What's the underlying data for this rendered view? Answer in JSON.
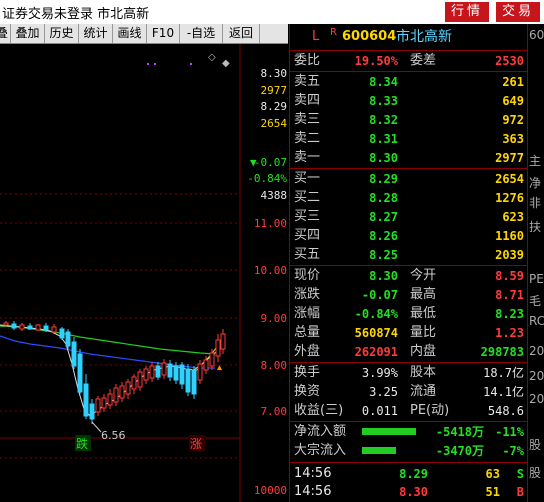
{
  "titlebar": {
    "status_text": "证券交易未登录  市北高新",
    "quote_button": "行情",
    "trade_button": "交易"
  },
  "toolbar": {
    "items": [
      "叠加",
      "历史",
      "统计",
      "画线",
      "F10",
      "-自选",
      "返回"
    ],
    "left_fragment": "叠"
  },
  "chart": {
    "price_axis": [
      "8.30",
      "2977",
      "8.29",
      "2654",
      "-0.07",
      "-0.84%",
      "4388"
    ],
    "grid_labels": [
      "11.00",
      "10.00",
      "9.00",
      "8.00",
      "7.00"
    ],
    "bottom_label": "10000",
    "low_annotation": "6.56",
    "tag_fall": "跌",
    "tag_rise": "涨",
    "colors": {
      "grid": "#7a0000",
      "candle_up": "#ff3b3b",
      "candle_down": "#30d0ff",
      "ma_green": "#22cc22",
      "ma_blue": "#2a4cff"
    }
  },
  "panel": {
    "header": {
      "letter": "L",
      "marker": "R",
      "code": "600604",
      "name": "市北高新"
    },
    "ratio": {
      "label": "委比",
      "pct": "19.50%",
      "label2": "委差",
      "value": "2530"
    },
    "asks": [
      {
        "label": "卖五",
        "price": "8.34",
        "vol": "261"
      },
      {
        "label": "卖四",
        "price": "8.33",
        "vol": "649"
      },
      {
        "label": "卖三",
        "price": "8.32",
        "vol": "972"
      },
      {
        "label": "卖二",
        "price": "8.31",
        "vol": "363"
      },
      {
        "label": "卖一",
        "price": "8.30",
        "vol": "2977"
      }
    ],
    "bids": [
      {
        "label": "买一",
        "price": "8.29",
        "vol": "2654"
      },
      {
        "label": "买二",
        "price": "8.28",
        "vol": "1276"
      },
      {
        "label": "买三",
        "price": "8.27",
        "vol": "623"
      },
      {
        "label": "买四",
        "price": "8.26",
        "vol": "1160"
      },
      {
        "label": "买五",
        "price": "8.25",
        "vol": "2039"
      }
    ],
    "stats": [
      {
        "l1": "现价",
        "v1": "8.30",
        "c1": "green",
        "l2": "今开",
        "v2": "8.59",
        "c2": "red"
      },
      {
        "l1": "涨跌",
        "v1": "-0.07",
        "c1": "green",
        "l2": "最高",
        "v2": "8.71",
        "c2": "red"
      },
      {
        "l1": "涨幅",
        "v1": "-0.84%",
        "c1": "green",
        "l2": "最低",
        "v2": "8.23",
        "c2": "green"
      },
      {
        "l1": "总量",
        "v1": "560874",
        "c1": "yellow",
        "l2": "量比",
        "v2": "1.23",
        "c2": "red"
      },
      {
        "l1": "外盘",
        "v1": "262091",
        "c1": "red",
        "l2": "内盘",
        "v2": "298783",
        "c2": "green"
      }
    ],
    "fund": [
      {
        "l1": "换手",
        "v1": "3.99%",
        "l2": "股本",
        "v2": "18.7亿"
      },
      {
        "l1": "换资",
        "v1": "3.25",
        "l2": "流通",
        "v2": "14.1亿"
      },
      {
        "l1": "收益(三)",
        "v1": "0.011",
        "l2": "PE(动)",
        "v2": "548.6"
      }
    ],
    "flows": [
      {
        "label": "净流入额",
        "amount": "-5418万",
        "pct": "-11%",
        "bar": 0.55
      },
      {
        "label": "大宗流入",
        "amount": "-3470万",
        "pct": "-7%",
        "bar": 0.35
      }
    ],
    "ticks": [
      {
        "time": "14:56",
        "price": "8.29",
        "vol": "63",
        "side": "S"
      },
      {
        "time": "14:56",
        "price": "8.30",
        "vol": "51",
        "side": "B"
      }
    ]
  },
  "farright": {
    "items": [
      "60",
      "主",
      "净",
      "非",
      "扶",
      "PE",
      "毛",
      "RC",
      "20",
      "20",
      "20",
      "股",
      "股"
    ]
  }
}
